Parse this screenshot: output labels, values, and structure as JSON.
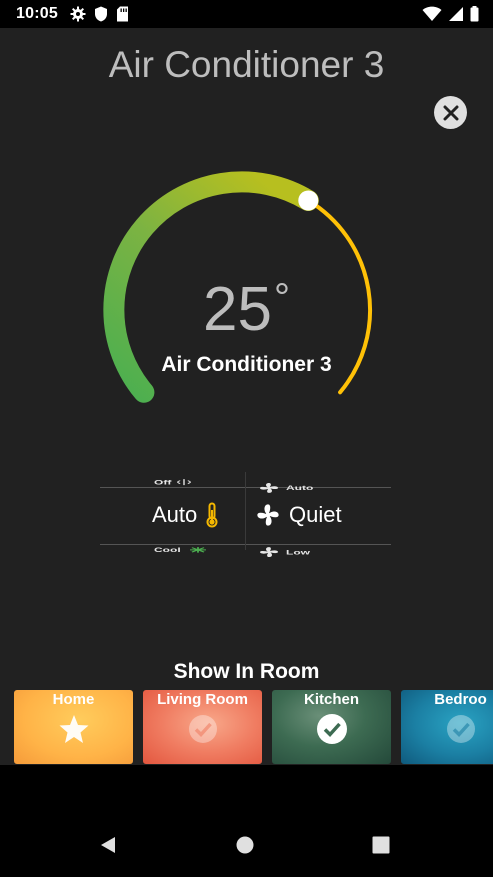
{
  "status_bar": {
    "time": "10:05",
    "left_icons": [
      "gear-icon",
      "shield-icon",
      "sd-card-icon"
    ],
    "right_icons": [
      "wifi-icon",
      "cell-signal-icon",
      "battery-icon"
    ]
  },
  "header": {
    "title": "Air Conditioner 3",
    "close_icon": "close-icon"
  },
  "thermostat": {
    "temperature": "25",
    "degree_symbol": "°",
    "device_name": "Air Conditioner 3",
    "level": 0.62,
    "colors": {
      "cool": "#4caf50",
      "mid": "#a8c42c",
      "warm": "#ffc107",
      "handle": "#ffffff"
    }
  },
  "mode_picker": {
    "above": {
      "label": "Off",
      "icon": "power-icon"
    },
    "selected": {
      "label": "Auto",
      "icon": "thermometer-icon",
      "icon_color": "#f5b800"
    },
    "below": {
      "label": "Cool",
      "icon": "snowflake-icon",
      "icon_color": "#4caf50"
    }
  },
  "fan_picker": {
    "above": {
      "label": "Auto",
      "icon": "fan-icon"
    },
    "selected": {
      "label": "Quiet",
      "icon": "fan-icon"
    },
    "below": {
      "label": "Low",
      "icon": "fan-icon"
    }
  },
  "show_in_room": {
    "title": "Show In Room",
    "rooms": [
      {
        "label": "Home",
        "icon": "star-icon",
        "selected": false,
        "color": "#ffbf47"
      },
      {
        "label": "Living Room",
        "icon": "check-circle-icon",
        "selected": false,
        "color": "#f2735a"
      },
      {
        "label": "Kitchen",
        "icon": "check-circle-icon",
        "selected": true,
        "color": "#3d6b52"
      },
      {
        "label": "Bedroo",
        "icon": "check-circle-icon",
        "selected": false,
        "color": "#1b7fa3"
      }
    ]
  },
  "nav_bar": {
    "buttons": [
      "back-icon",
      "home-icon",
      "recents-icon"
    ]
  }
}
